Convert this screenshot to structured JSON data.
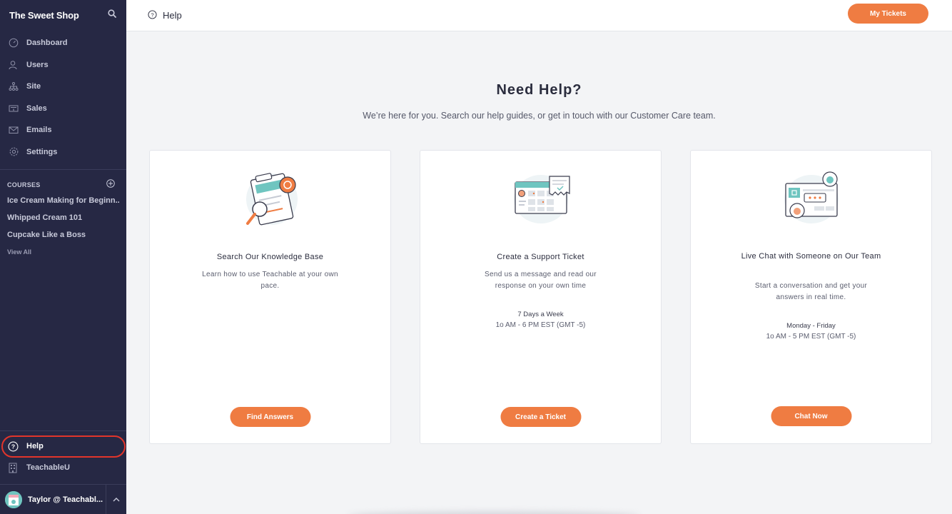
{
  "sidebar": {
    "brand": "The Sweet Shop",
    "nav": [
      {
        "label": "Dashboard",
        "icon": "speedometer-icon"
      },
      {
        "label": "Users",
        "icon": "users-icon"
      },
      {
        "label": "Site",
        "icon": "sitemap-icon"
      },
      {
        "label": "Sales",
        "icon": "money-icon"
      },
      {
        "label": "Emails",
        "icon": "envelope-icon"
      },
      {
        "label": "Settings",
        "icon": "gear-icon"
      }
    ],
    "courses_title": "COURSES",
    "courses": [
      "Ice Cream Making for Beginn...",
      "Whipped Cream 101",
      "Cupcake Like a Boss"
    ],
    "view_all": "View All",
    "help": "Help",
    "teachableu": "TeachableU",
    "user": "Taylor @ Teachabl..."
  },
  "topbar": {
    "title": "Help",
    "my_tickets": "My Tickets"
  },
  "main": {
    "headline": "Need Help?",
    "subline": "We’re here for you. Search our help guides, or get in touch with our Customer Care team.",
    "cards": [
      {
        "title": "Search Our Knowledge Base",
        "desc": "Learn how to use Teachable at your own pace.",
        "hours_days": "",
        "hours_time": "",
        "button": "Find Answers"
      },
      {
        "title": "Create a Support Ticket",
        "desc": "Send us a message and read our response on your own time",
        "hours_days": "7 Days a Week",
        "hours_time": "1o AM - 6 PM EST (GMT -5)",
        "button": "Create a Ticket"
      },
      {
        "title": "Live Chat with Someone on Our Team",
        "desc": "Start a conversation and get your answers in real time.",
        "hours_days": "Monday - Friday",
        "hours_time": "1o AM - 5 PM EST (GMT -5)",
        "button": "Chat Now"
      }
    ]
  },
  "colors": {
    "sidebar_bg": "#262844",
    "accent": "#ef7c42",
    "highlight_ring": "#e2352b",
    "teal": "#6fc5c0"
  }
}
